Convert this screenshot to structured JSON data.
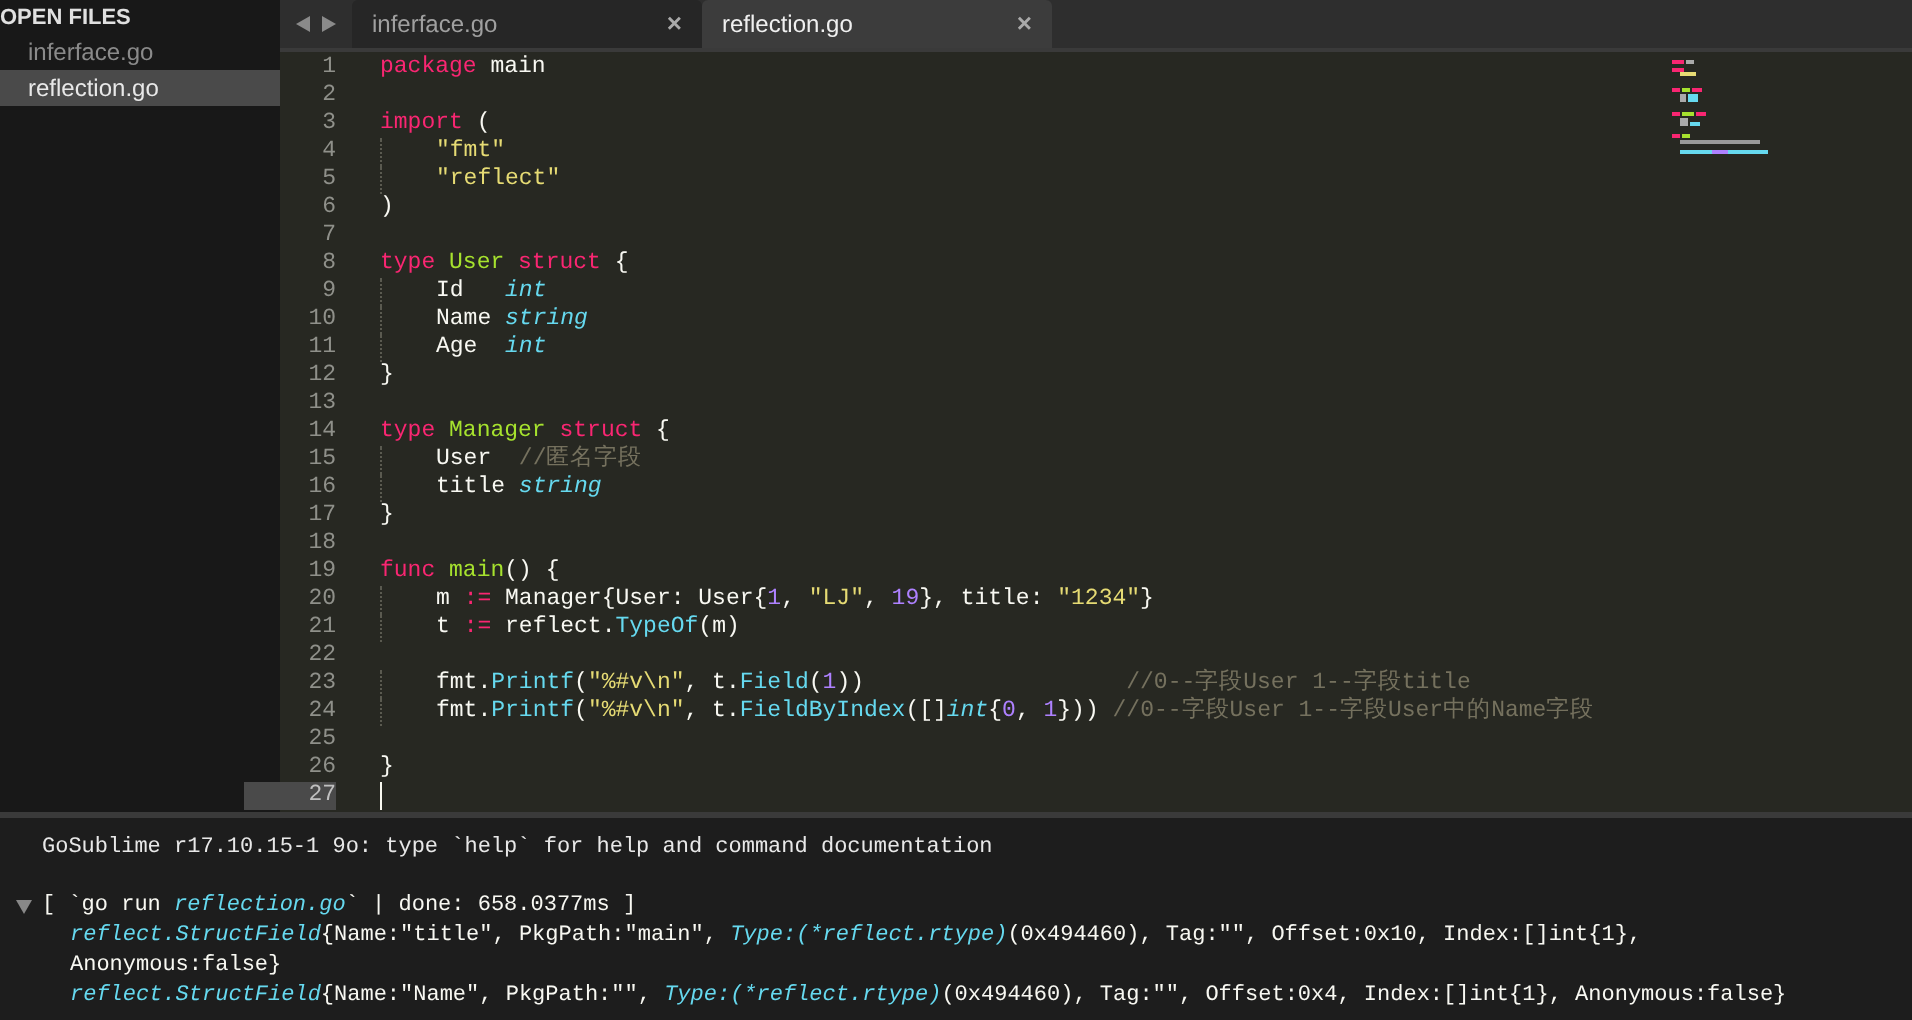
{
  "sidebar": {
    "header": "OPEN FILES",
    "items": [
      {
        "label": "inferface.go",
        "selected": false
      },
      {
        "label": "reflection.go",
        "selected": true
      }
    ]
  },
  "tabs": [
    {
      "label": "inferface.go",
      "selected": false,
      "close": "×"
    },
    {
      "label": "reflection.go",
      "selected": true,
      "close": "×"
    }
  ],
  "editor": {
    "lines": [
      {
        "number": "1",
        "current": false,
        "indented": false,
        "tokens": [
          {
            "kind": "keyword",
            "text": "package"
          },
          {
            "kind": "plain",
            "text": " main"
          }
        ]
      },
      {
        "number": "2",
        "current": false
      },
      {
        "number": "3",
        "current": false,
        "indented": false,
        "tokens": [
          {
            "kind": "keyword",
            "text": "import"
          },
          {
            "kind": "plain",
            "text": " ("
          }
        ]
      },
      {
        "number": "4",
        "current": false,
        "indented": true,
        "tokens": [
          {
            "kind": "string",
            "text": "\"fmt\""
          }
        ]
      },
      {
        "number": "5",
        "current": false,
        "indented": true,
        "tokens": [
          {
            "kind": "string",
            "text": "\"reflect\""
          }
        ]
      },
      {
        "number": "6",
        "current": false,
        "indented": false,
        "tokens": [
          {
            "kind": "plain",
            "text": ")"
          }
        ]
      },
      {
        "number": "7",
        "current": false
      },
      {
        "number": "8",
        "current": false,
        "indented": false,
        "tokens": [
          {
            "kind": "keyword",
            "text": "type "
          },
          {
            "kind": "type",
            "text": "User "
          },
          {
            "kind": "keyword",
            "text": "struct"
          },
          {
            "kind": "plain",
            "text": " {"
          }
        ]
      },
      {
        "number": "9",
        "current": false,
        "indented": true,
        "tokens": [
          {
            "kind": "plain",
            "text": "Id   "
          },
          {
            "kind": "builtin",
            "text": "int"
          }
        ]
      },
      {
        "number": "10",
        "current": false,
        "indented": true,
        "tokens": [
          {
            "kind": "plain",
            "text": "Name "
          },
          {
            "kind": "builtin",
            "text": "string"
          }
        ]
      },
      {
        "number": "11",
        "current": false,
        "indented": true,
        "tokens": [
          {
            "kind": "plain",
            "text": "Age  "
          },
          {
            "kind": "builtin",
            "text": "int"
          }
        ]
      },
      {
        "number": "12",
        "current": false,
        "indented": false,
        "tokens": [
          {
            "kind": "plain",
            "text": "}"
          }
        ]
      },
      {
        "number": "13",
        "current": false
      },
      {
        "number": "14",
        "current": false,
        "indented": false,
        "tokens": [
          {
            "kind": "keyword",
            "text": "type "
          },
          {
            "kind": "type",
            "text": "Manager "
          },
          {
            "kind": "keyword",
            "text": "struct"
          },
          {
            "kind": "plain",
            "text": " {"
          }
        ]
      },
      {
        "number": "15",
        "current": false,
        "indented": true,
        "tokens": [
          {
            "kind": "plain",
            "text": "User  "
          },
          {
            "kind": "comment",
            "text": "//匿名字段"
          }
        ]
      },
      {
        "number": "16",
        "current": false,
        "indented": true,
        "tokens": [
          {
            "kind": "plain",
            "text": "title "
          },
          {
            "kind": "builtin",
            "text": "string"
          }
        ]
      },
      {
        "number": "17",
        "current": false,
        "indented": false,
        "tokens": [
          {
            "kind": "plain",
            "text": "}"
          }
        ]
      },
      {
        "number": "18",
        "current": false
      },
      {
        "number": "19",
        "current": false,
        "indented": false,
        "tokens": [
          {
            "kind": "keyword",
            "text": "func "
          },
          {
            "kind": "type",
            "text": "main"
          },
          {
            "kind": "plain",
            "text": "() {"
          }
        ]
      },
      {
        "number": "20",
        "current": false,
        "indented": true,
        "tokens": [
          {
            "kind": "plain",
            "text": "m "
          },
          {
            "kind": "keyword",
            "text": ":="
          },
          {
            "kind": "plain",
            "text": " Manager{User: User{"
          },
          {
            "kind": "number",
            "text": "1"
          },
          {
            "kind": "plain",
            "text": ", "
          },
          {
            "kind": "string",
            "text": "\"LJ\""
          },
          {
            "kind": "plain",
            "text": ", "
          },
          {
            "kind": "number",
            "text": "19"
          },
          {
            "kind": "plain",
            "text": "}, title: "
          },
          {
            "kind": "string",
            "text": "\"1234\""
          },
          {
            "kind": "plain",
            "text": "}"
          }
        ]
      },
      {
        "number": "21",
        "current": false,
        "indented": true,
        "tokens": [
          {
            "kind": "plain",
            "text": "t "
          },
          {
            "kind": "keyword",
            "text": ":="
          },
          {
            "kind": "plain",
            "text": " reflect."
          },
          {
            "kind": "func",
            "text": "TypeOf"
          },
          {
            "kind": "plain",
            "text": "(m)"
          }
        ]
      },
      {
        "number": "22",
        "current": false
      },
      {
        "number": "23",
        "current": false,
        "indented": true,
        "tokens": [
          {
            "kind": "plain",
            "text": "fmt."
          },
          {
            "kind": "func",
            "text": "Printf"
          },
          {
            "kind": "plain",
            "text": "("
          },
          {
            "kind": "string",
            "text": "\"%#v\\n\""
          },
          {
            "kind": "plain",
            "text": ", t."
          },
          {
            "kind": "func",
            "text": "Field"
          },
          {
            "kind": "plain",
            "text": "("
          },
          {
            "kind": "number",
            "text": "1"
          },
          {
            "kind": "plain",
            "text": "))                   "
          },
          {
            "kind": "comment",
            "text": "//0--字段User 1--字段title"
          }
        ]
      },
      {
        "number": "24",
        "current": false,
        "indented": true,
        "tokens": [
          {
            "kind": "plain",
            "text": "fmt."
          },
          {
            "kind": "func",
            "text": "Printf"
          },
          {
            "kind": "plain",
            "text": "("
          },
          {
            "kind": "string",
            "text": "\"%#v\\n\""
          },
          {
            "kind": "plain",
            "text": ", t."
          },
          {
            "kind": "func",
            "text": "FieldByIndex"
          },
          {
            "kind": "plain",
            "text": "([]"
          },
          {
            "kind": "builtin",
            "text": "int"
          },
          {
            "kind": "plain",
            "text": "{"
          },
          {
            "kind": "number",
            "text": "0"
          },
          {
            "kind": "plain",
            "text": ", "
          },
          {
            "kind": "number",
            "text": "1"
          },
          {
            "kind": "plain",
            "text": "})) "
          },
          {
            "kind": "comment",
            "text": "//0--字段User 1--字段User中的Name字段"
          }
        ]
      },
      {
        "number": "25",
        "current": false
      },
      {
        "number": "26",
        "current": false,
        "indented": false,
        "tokens": [
          {
            "kind": "plain",
            "text": "}"
          }
        ]
      },
      {
        "number": "27",
        "current": true
      }
    ]
  },
  "console": {
    "banner": "GoSublime r17.10.15-1 9o: type `help` for help and command documentation",
    "run": {
      "expanded": true,
      "header": [
        {
          "kind": "plain",
          "text": "[ `go run "
        },
        {
          "kind": "builtin",
          "text": "reflection.go"
        },
        {
          "kind": "plain",
          "text": "` | done: 658.0377ms ]"
        }
      ],
      "output": [
        [
          {
            "kind": "builtin",
            "text": "reflect.StructField"
          },
          {
            "kind": "plain",
            "text": "{Name:\"title\", PkgPath:\"main\", "
          },
          {
            "kind": "builtin",
            "text": "Type:(*reflect.rtype)"
          },
          {
            "kind": "plain",
            "text": "(0x494460), Tag:\"\", Offset:0x10, Index:[]int{1},"
          }
        ],
        [
          {
            "kind": "plain",
            "text": "Anonymous:false}"
          }
        ],
        [
          {
            "kind": "builtin",
            "text": "reflect.StructField"
          },
          {
            "kind": "plain",
            "text": "{Name:\"Name\", PkgPath:\"\", "
          },
          {
            "kind": "builtin",
            "text": "Type:(*reflect.rtype)"
          },
          {
            "kind": "plain",
            "text": "(0x494460), Tag:\"\", Offset:0x4, Index:[]int{1}, Anonymous:false}"
          }
        ]
      ]
    }
  }
}
